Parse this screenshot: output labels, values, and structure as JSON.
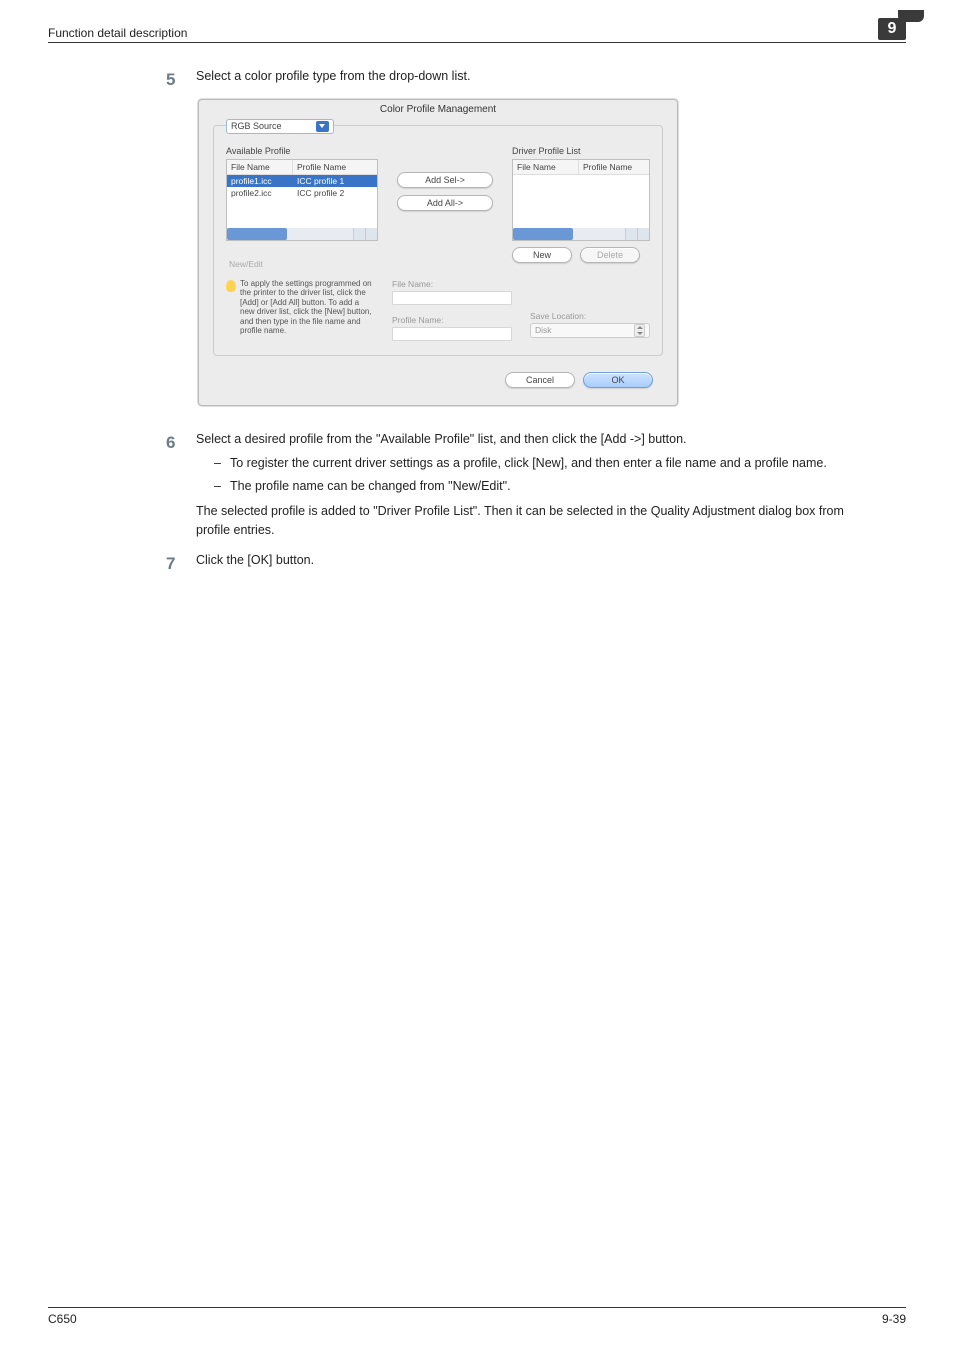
{
  "header": {
    "title": "Function detail description",
    "chapter": "9"
  },
  "steps": {
    "s5": {
      "num": "5",
      "text": "Select a color profile type from the drop-down list."
    },
    "s6": {
      "num": "6",
      "text": "Select a desired profile from the \"Available Profile\" list, and then click the [Add ->] button.",
      "sub1": "To register the current driver settings as a profile, click [New], and then enter a file name and a profile name.",
      "sub2": "The profile name can be changed from \"New/Edit\".",
      "after": "The selected profile is added to \"Driver Profile List\". Then it can be selected in the Quality Adjustment dialog box from profile entries."
    },
    "s7": {
      "num": "7",
      "text": "Click the [OK] button."
    }
  },
  "dialog": {
    "title": "Color Profile Management",
    "source_select": "RGB Source",
    "available_label": "Available Profile",
    "driver_label": "Driver Profile List",
    "col_file": "File Name",
    "col_profile": "Profile Name",
    "rows": {
      "r1_file": "profile1.icc",
      "r1_prof": "ICC profile 1",
      "r2_file": "profile2.icc",
      "r2_prof": "ICC profile 2"
    },
    "btn_addsel": "Add Sel->",
    "btn_addall": "Add All->",
    "btn_new": "New",
    "btn_delete": "Delete",
    "newedit_label": "New/Edit",
    "help_text": "To apply the settings programmed on the printer to the driver list, click the [Add] or [Add All] button. To add a new driver list, click the [New] button, and then type in the file name and profile name.",
    "file_label": "File Name:",
    "profile_label": "Profile Name:",
    "save_label": "Save Location:",
    "save_value": "Disk",
    "btn_cancel": "Cancel",
    "btn_ok": "OK"
  },
  "footer": {
    "left": "C650",
    "right": "9-39"
  }
}
